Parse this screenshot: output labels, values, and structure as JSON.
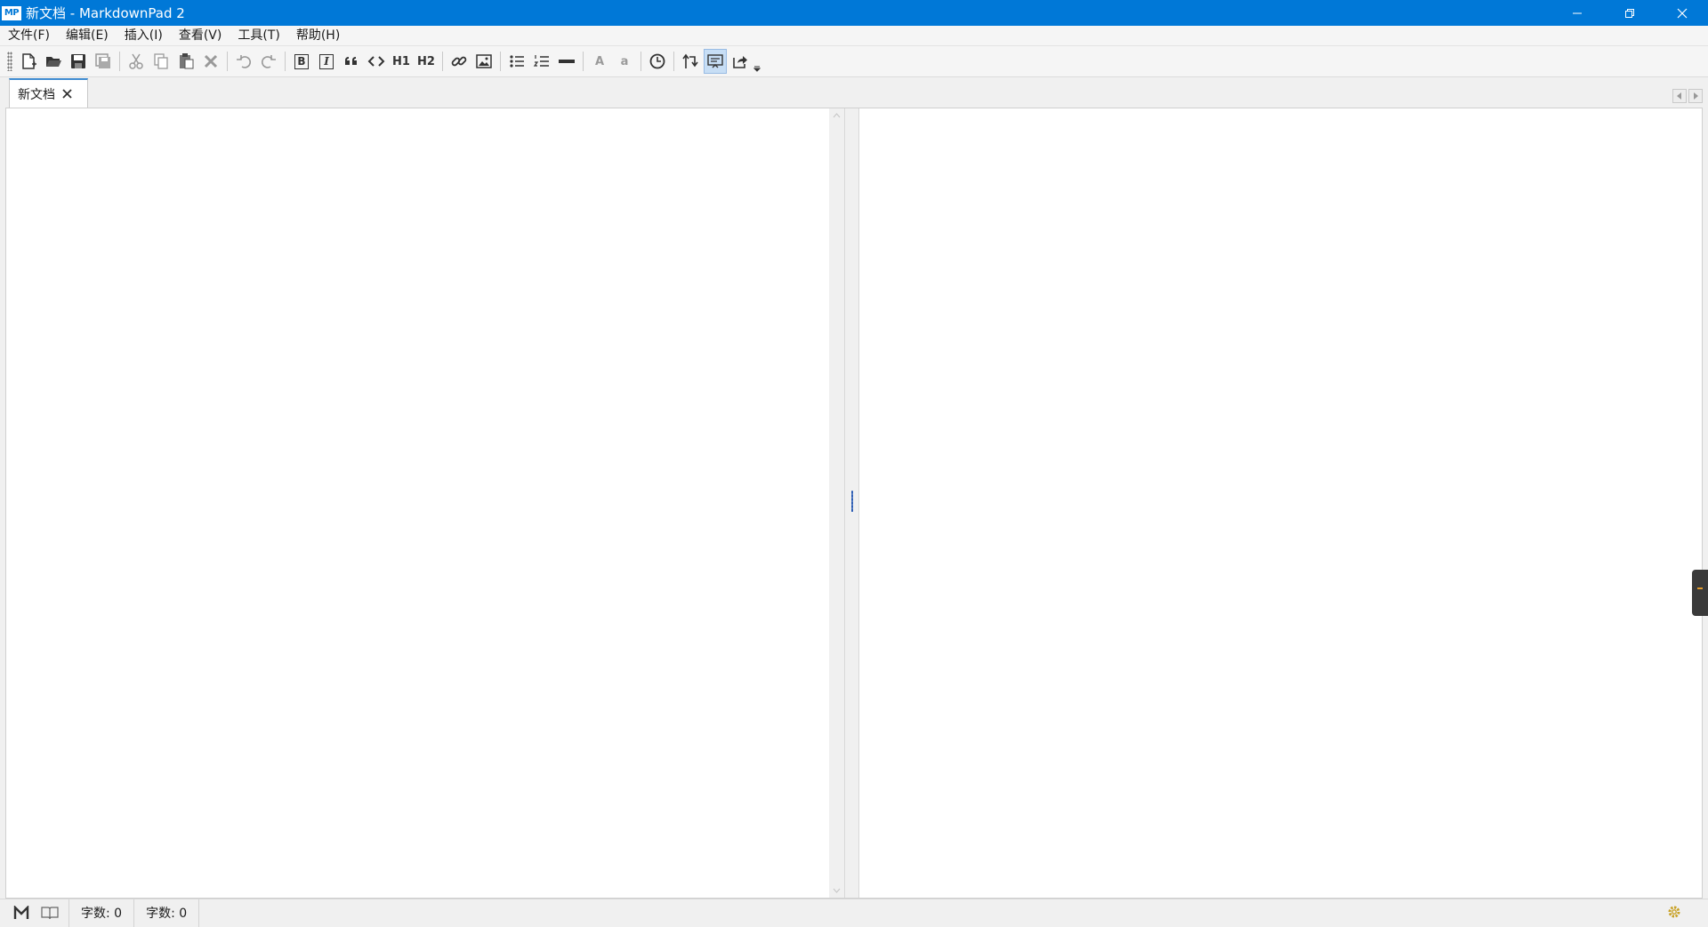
{
  "window": {
    "app_badge": "MP",
    "title": "新文档 - MarkdownPad 2"
  },
  "menu": [
    {
      "label": "文件(F)"
    },
    {
      "label": "编辑(E)"
    },
    {
      "label": "插入(I)"
    },
    {
      "label": "查看(V)"
    },
    {
      "label": "工具(T)"
    },
    {
      "label": "帮助(H)"
    }
  ],
  "toolbar": {
    "icons": [
      "new-document-icon",
      "open-folder-icon",
      "save-icon",
      "save-all-icon",
      "cut-icon",
      "copy-icon",
      "paste-icon",
      "delete-icon",
      "undo-icon",
      "redo-icon",
      "bold-icon",
      "italic-icon",
      "quote-icon",
      "code-icon",
      "h1-icon",
      "h2-icon",
      "link-icon",
      "image-icon",
      "bullet-list-icon",
      "numbered-list-icon",
      "horizontal-rule-icon",
      "uppercase-icon",
      "lowercase-icon",
      "timestamp-icon",
      "sync-scroll-icon",
      "live-preview-icon",
      "export-icon"
    ],
    "bold_text": "B",
    "italic_text": "I",
    "h1_text": "H1",
    "h2_text": "H2",
    "upper_text": "A",
    "lower_text": "a",
    "active_button": "live-preview"
  },
  "tabs": [
    {
      "label": "新文档",
      "active": true
    }
  ],
  "status": {
    "word_count_label": "字数: 0",
    "char_count_label": "字数: 0"
  },
  "colors": {
    "titlebar": "#0078d7",
    "tab_accent": "#3f8cd1",
    "active_tool_bg": "#c7def5"
  }
}
